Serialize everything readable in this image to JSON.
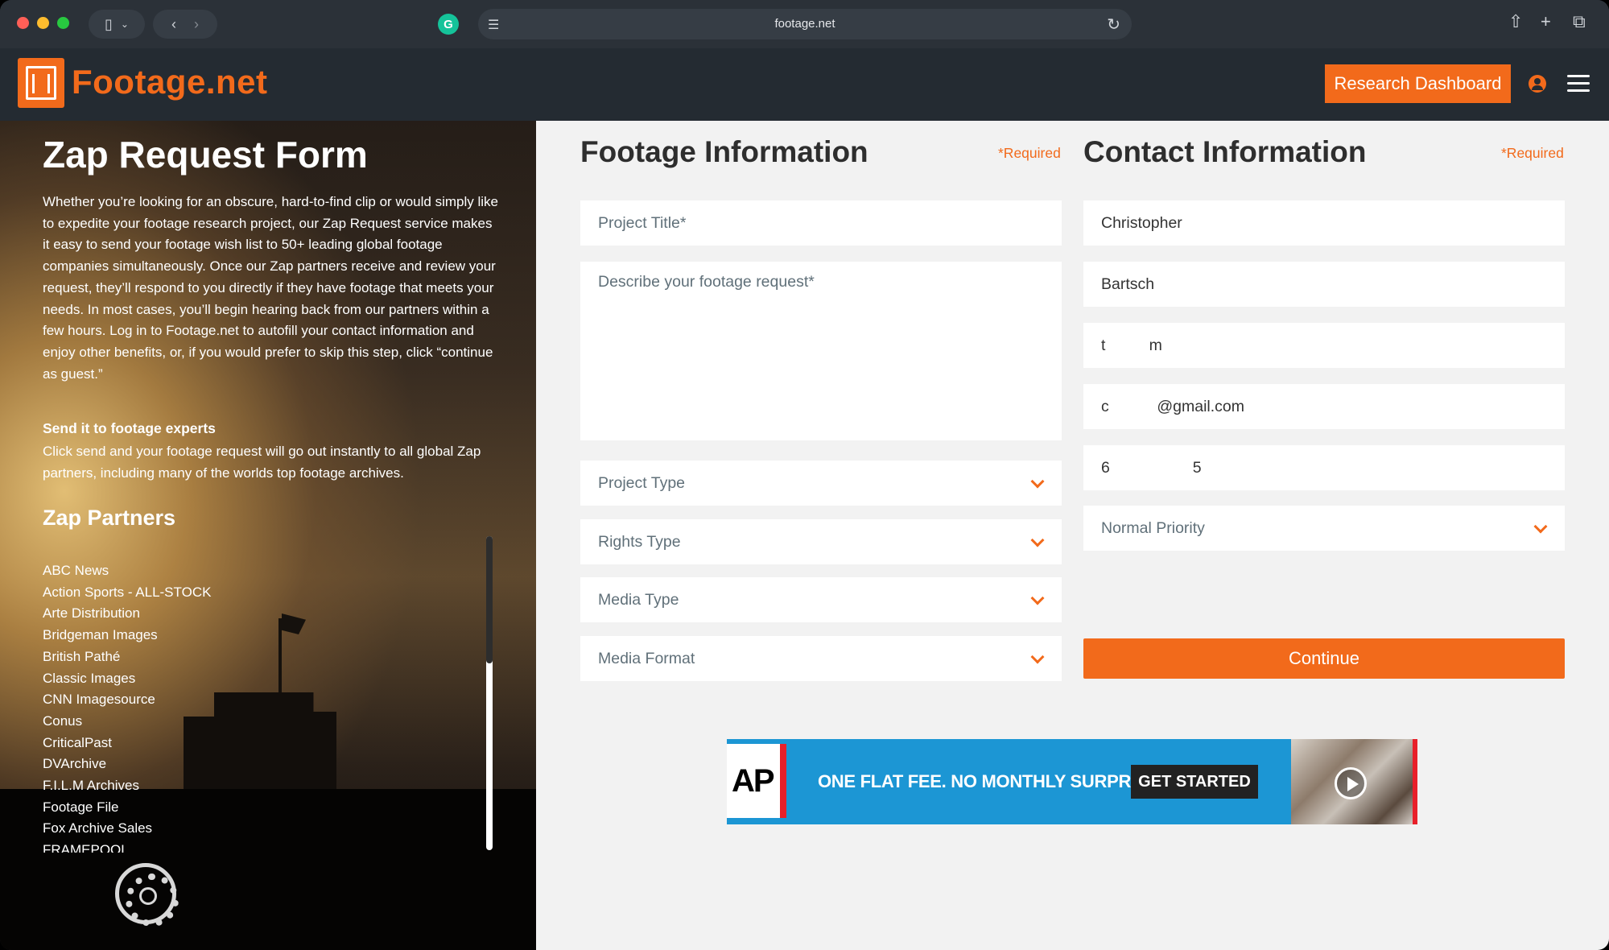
{
  "browser": {
    "url": "footage.net",
    "icons": [
      "sidebar-icon",
      "chevron-down-icon",
      "back-icon",
      "forward-icon",
      "grammarly-icon",
      "reader-icon",
      "reload-icon",
      "share-icon",
      "new-tab-icon",
      "tabs-icon"
    ]
  },
  "header": {
    "logo_text": "Footage.net",
    "research_button": "Research Dashboard",
    "accent_color": "#f26a1b"
  },
  "left": {
    "title": "Zap Request Form",
    "description": "Whether you’re looking for an obscure, hard-to-find clip or would simply like to expedite your footage research project, our Zap Request service makes it easy to send your footage wish list to 50+ leading global footage companies simultaneously. Once our Zap partners receive and review your request, they’ll respond to you directly if they have footage that meets your needs. In most cases, you’ll begin hearing back from our partners within a few hours. Log in to Footage.net to autofill your contact information and enjoy other benefits, or, if you would prefer to skip this step, click “continue as guest.”",
    "sub_title": "Send it to footage experts",
    "sub_text": "Click send and your footage request will go out instantly to all global Zap partners, including many of the worlds top footage archives.",
    "partners_title": "Zap Partners",
    "partners": [
      "ABC News",
      "Action Sports - ALL-STOCK",
      "Arte Distribution",
      "Bridgeman Images",
      "British Pathé",
      "Classic Images",
      "CNN Imagesource",
      "Conus",
      "CriticalPast",
      "DVArchive",
      "F.I.L.M Archives",
      "Footage File",
      "Fox Archive Sales",
      "FRAMEPOOL"
    ]
  },
  "footage": {
    "title": "Footage Information",
    "required": "*Required",
    "project_title_placeholder": "Project Title*",
    "describe_placeholder": "Describe your footage request*",
    "project_type": "Project Type",
    "rights_type": "Rights Type",
    "media_type": "Media Type",
    "media_format": "Media Format"
  },
  "contact": {
    "title": "Contact Information",
    "required": "*Required",
    "first_name": "Christopher",
    "last_name": "Bartsch",
    "company": "t          m",
    "email": "c           @gmail.com",
    "phone": "6                   5",
    "priority": "Normal Priority",
    "continue": "Continue"
  },
  "ad": {
    "logo": "AP",
    "tagline": "ONE FLAT FEE. NO MONTHLY SURPRISES.",
    "cta": "GET STARTED"
  }
}
